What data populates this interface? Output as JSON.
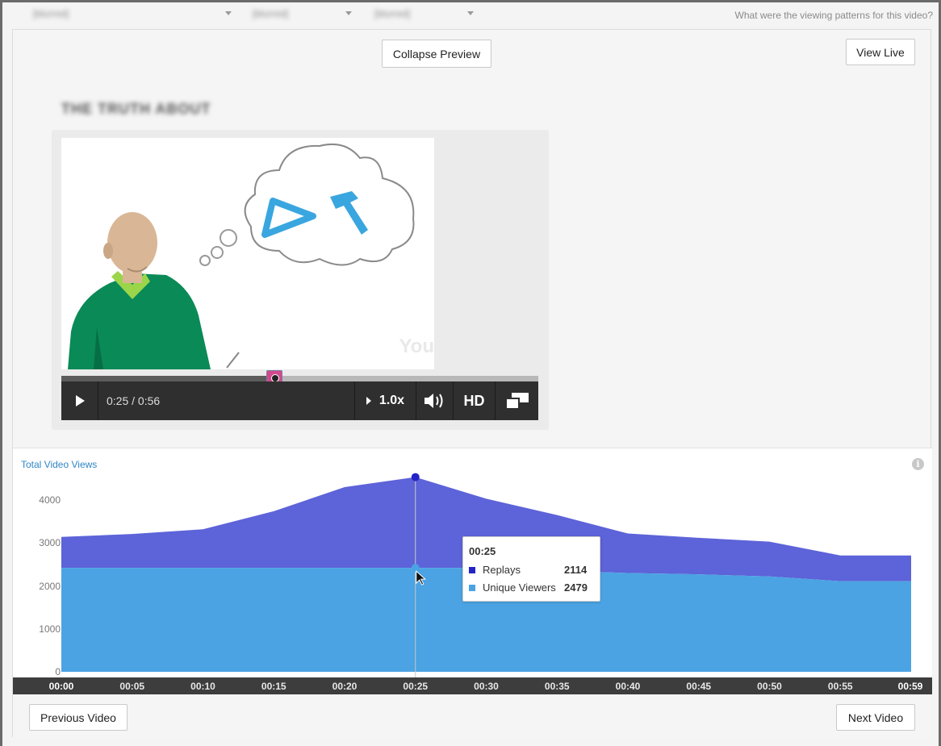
{
  "topbar": {
    "crumbs": [
      "[blurred]",
      "[blurred]",
      "[blurred]"
    ],
    "question": "What were the viewing patterns for this video?"
  },
  "preview": {
    "collapse_label": "Collapse Preview",
    "view_live_label": "View Live",
    "video_title": "THE TRUTH ABOUT",
    "watermark": "You"
  },
  "player": {
    "time_display": "0:25 / 0:56",
    "speed_label": "1.0x",
    "hd_label": "HD",
    "progress": 0.446
  },
  "chart": {
    "title": "Total Video Views",
    "legend_note": "",
    "tooltip": {
      "time": "00:25",
      "rows": [
        {
          "label": "Replays",
          "value": "2114",
          "color": "#2323c7"
        },
        {
          "label": "Unique Viewers",
          "value": "2479",
          "color": "#4ba3e3"
        }
      ]
    }
  },
  "chart_data": {
    "type": "area",
    "title": "Total Video Views",
    "x": [
      "00:00",
      "00:05",
      "00:10",
      "00:15",
      "00:20",
      "00:25",
      "00:30",
      "00:35",
      "00:40",
      "00:45",
      "00:50",
      "00:55",
      "00:59"
    ],
    "series": [
      {
        "name": "Unique Viewers",
        "color": "#4ba3e3",
        "values": [
          2420,
          2420,
          2420,
          2420,
          2420,
          2420,
          2420,
          2360,
          2300,
          2270,
          2220,
          2110,
          2110
        ]
      },
      {
        "name": "Replays",
        "color": "#5d63d8",
        "values": [
          720,
          790,
          900,
          1320,
          1880,
          2114,
          1610,
          1290,
          920,
          850,
          810,
          600,
          600
        ]
      }
    ],
    "ylim": [
      0,
      4500
    ],
    "yticks": [
      0,
      1000,
      2000,
      3000,
      4000
    ],
    "stacked": true,
    "highlight_index": 5,
    "grid": false
  },
  "nav": {
    "previous_label": "Previous Video",
    "next_label": "Next Video"
  }
}
